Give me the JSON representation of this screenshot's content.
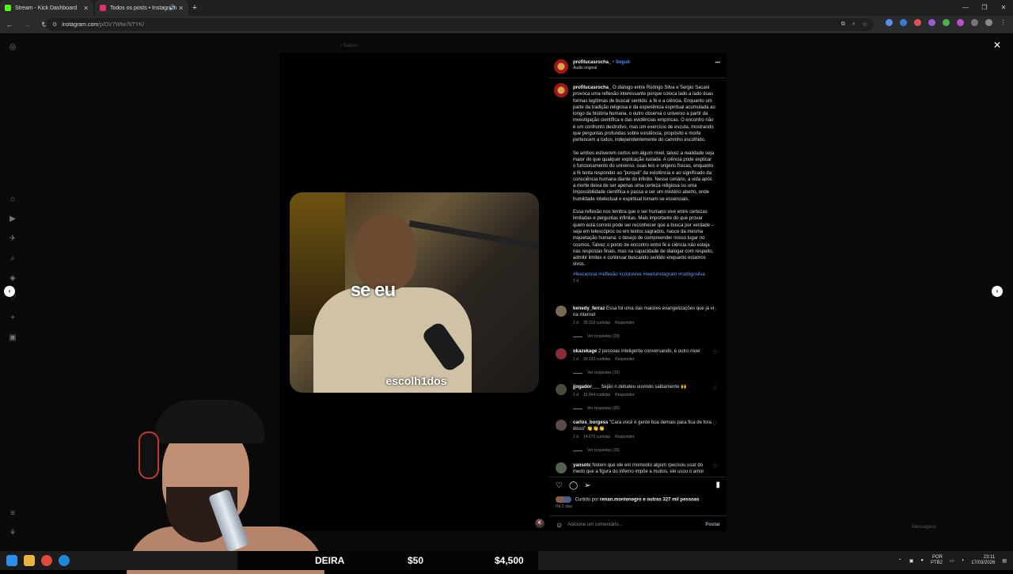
{
  "browser": {
    "tabs": [
      {
        "label": "Stream - Kick Dashboard",
        "favicon_color": "#53fc18",
        "active": true
      },
      {
        "label": "Todos os posts • Instagram",
        "favicon_color": "#e1306c",
        "active": false
      }
    ],
    "url_domain": "instagram.com",
    "url_path": "/p/DV7Wtw7kTYK/"
  },
  "ghost_breadcrumb": "‹ Salvos",
  "post": {
    "username": "profilucasrocha_",
    "follow_label": "Seguir",
    "audio": "Áudio original",
    "more_label": "•••",
    "caption_paragraphs": [
      "O diálogo entre Rodrigo Silva e Sergio Sacani provoca uma reflexão interessante porque coloca lado a lado duas formas legítimas de buscar sentido: a fé e a ciência. Enquanto um parte da tradição religiosa e da experiência espiritual acumulada ao longo da história humana, o outro observa o universo a partir da investigação científica e das evidências empíricas. O encontro não é um confronto destrutivo, mas um exercício de escuta, mostrando que perguntas profundas sobre existência, propósito e morte pertencem a todos, independentemente do caminho escolhido.",
      "Se ambos estiverem certos em algum nível, talvez a realidade seja maior do que qualquer explicação isolada. A ciência pode explicar o funcionamento do universo, suas leis e origens físicas, enquanto a fé tenta responder ao \"porquê\" da existência e ao significado da consciência humana diante do infinito. Nesse cenário, a vida após a morte deixa de ser apenas uma certeza religiosa ou uma impossibilidade científica e passa a ser um mistério aberto, onde humildade intelectual e espiritual tornam-se essenciais.",
      "Essa reflexão nos lembra que o ser humano vive entre certezas limitadas e perguntas infinitas. Mais importante do que provar quem está correto pode ser reconhecer que a busca por verdade – seja em telescópios ou em textos sagrados, nasce da mesma inquietação humana: o desejo de compreender nosso lugar no cosmos. Talvez o ponto de encontro entre fé e ciência não esteja nas respostas finais, mas na capacidade de dialogar com respeito, admitir limites e continuar buscando sentido enquanto estamos vivos."
    ],
    "hashtags": "#feeciencia #reflexão #cristovive #reelsinstagram #rodrigosilva",
    "caption_age": "2 d",
    "video_caption_big": "se eu",
    "video_caption_small": "escolh1dos",
    "comments": [
      {
        "user": "kenedy_ferraz",
        "text": "Essa foi uma das maiores evangelizações que já vi na internet",
        "age": "1 d",
        "likes": "39.316 curtidas",
        "reply": "Responder",
        "replies": "Ver respostas (29)"
      },
      {
        "user": "okazekage",
        "text": "2 pessoas inteligente conversando, é outro nivel",
        "age": "1 d",
        "likes": "30.122 curtidas",
        "reply": "Responder",
        "replies": "Ver respostas (16)"
      },
      {
        "user": "jjogador___",
        "text": "Sejão n debateu ouvindo sabiamente 🙌",
        "age": "1 d",
        "likes": "15.944 curtidas",
        "reply": "Responder",
        "replies": "Ver respostas (20)"
      },
      {
        "user": "carlos_borgess",
        "text": "\"Cara você é gente boa demais para fica de fora disso\" 👏👏👏",
        "age": "1 d",
        "likes": "14.670 curtidas",
        "reply": "Responder",
        "replies": "Ver respostas (16)"
      },
      {
        "user": "yansotc",
        "text": "Notem que ele em momento algum rpecisou usar do medo que a figura do inferno impõe a muitos, ele usou o amor",
        "age": "",
        "likes": "",
        "reply": "",
        "replies": ""
      }
    ],
    "liked_by_prefix": "Curtido por",
    "liked_by_user": "renan.montenegro",
    "liked_by_suffix": "e outras 327 mil pessoas",
    "post_age": "Há 2 dias",
    "comment_placeholder": "Adicione um comentário...",
    "post_button": "Postar"
  },
  "stream_overlay": {
    "ticker_left": "DEIRA",
    "ticker_mid": "$50",
    "ticker_right": "$4,500",
    "messages_label": "Mensagens"
  },
  "taskbar": {
    "lang": "POR",
    "layout": "PTB2",
    "time": "23:11",
    "date": "17/03/2026"
  }
}
